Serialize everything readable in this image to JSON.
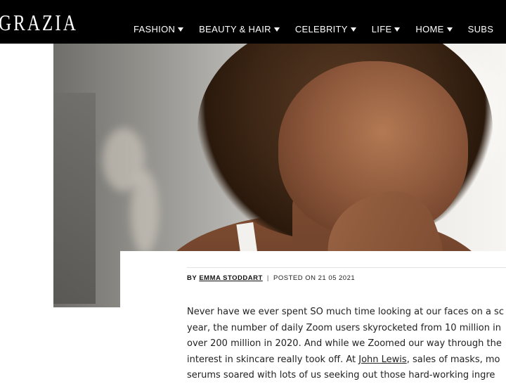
{
  "header": {
    "logo": "GRAZIA",
    "nav": [
      {
        "label": "FASHION"
      },
      {
        "label": "BEAUTY & HAIR"
      },
      {
        "label": "CELEBRITY"
      },
      {
        "label": "LIFE"
      },
      {
        "label": "HOME"
      },
      {
        "label": "SUBS"
      }
    ]
  },
  "article": {
    "byline": {
      "by": "BY",
      "author": "EMMA STODDART",
      "separator": "|",
      "posted": "POSTED ON 21 05 2021"
    },
    "body_lines": [
      "Never have we ever spent SO much time looking at our faces on a sc",
      "year, the number of daily Zoom users skyrocketed from 10 million in",
      "over 200 million in 2020. And while we Zoomed our way through the",
      {
        "pre": "interest in skincare really took off. At ",
        "link": "John Lewis",
        "post": ", sales of masks, mo"
      },
      "serums soared with lots of us seeking out those hard-working ingre"
    ]
  },
  "colors": {
    "header_bg": "#000000",
    "header_text": "#ffffff",
    "body_text": "#222222"
  }
}
